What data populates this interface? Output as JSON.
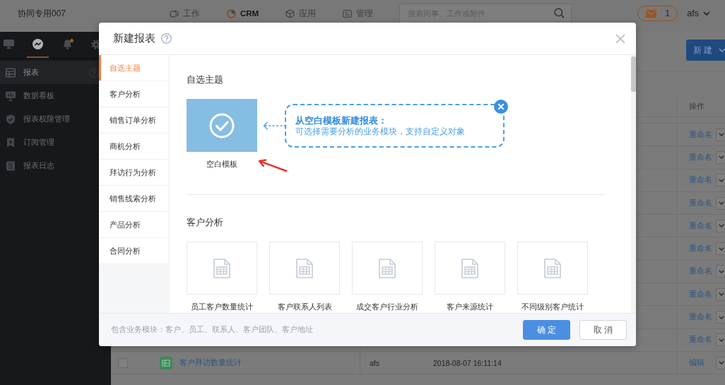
{
  "top_bar": {
    "company": "协同专用007",
    "nav": [
      {
        "label": "工作",
        "selected": false
      },
      {
        "label": "CRM",
        "selected": true
      },
      {
        "label": "应用",
        "selected": false
      },
      {
        "label": "管理",
        "selected": false
      }
    ],
    "search": {
      "placeholder": "搜索同事、工作或附件"
    },
    "messages": {
      "count": "1"
    },
    "user": "afs"
  },
  "sidebar": {
    "tabs": [
      {
        "selected": false,
        "unread": false
      },
      {
        "selected": true,
        "unread": false
      },
      {
        "selected": false,
        "unread": true
      },
      {
        "selected": false,
        "unread": false
      }
    ],
    "items": [
      {
        "label": "报表",
        "selected": true,
        "help": true
      },
      {
        "label": "数据看板",
        "selected": false,
        "help": false
      },
      {
        "label": "报表权限管理",
        "selected": false,
        "help": false
      },
      {
        "label": "订阅管理",
        "selected": false,
        "help": false
      },
      {
        "label": "报表日志",
        "selected": false,
        "help": false
      }
    ]
  },
  "main": {
    "new_button": "新 建",
    "table": {
      "action_header": "操作",
      "rows": [
        {
          "action": "重命名"
        },
        {
          "action": "重命名"
        },
        {
          "action": "重命名"
        },
        {
          "action": "重命名"
        },
        {
          "action": "重命名"
        },
        {
          "action": "重命名"
        },
        {
          "action": "重命名"
        },
        {
          "action": "重命名"
        },
        {
          "action": "重命名"
        },
        {
          "action": "重命名"
        },
        {
          "checked": false,
          "name": "客户拜访数量统计",
          "creator": "afs",
          "time": "2018-08-07 16:11:14",
          "action": "编辑"
        }
      ]
    }
  },
  "dialog": {
    "title": "新建报表",
    "nav": [
      {
        "label": "自选主题",
        "selected": true
      },
      {
        "label": "客户分析",
        "selected": false
      },
      {
        "label": "销售订单分析",
        "selected": false
      },
      {
        "label": "商机分析",
        "selected": false
      },
      {
        "label": "拜访行为分析",
        "selected": false
      },
      {
        "label": "销售线索分析",
        "selected": false
      },
      {
        "label": "产品分析",
        "selected": false
      },
      {
        "label": "合同分析",
        "selected": false
      }
    ],
    "sections": [
      {
        "title": "自选主题",
        "templates": [
          {
            "label": "空白模板",
            "selected": true
          }
        ],
        "callout": {
          "title": "从空白模板新建报表：",
          "text": "可选择需要分析的业务模块，支持自定义对象"
        }
      },
      {
        "title": "客户分析",
        "templates": [
          {
            "label": "员工客户数量统计",
            "selected": false
          },
          {
            "label": "客户联系人列表",
            "selected": false
          },
          {
            "label": "成交客户行业分析",
            "selected": false
          },
          {
            "label": "客户来源统计",
            "selected": false
          },
          {
            "label": "不同级别客户统计",
            "selected": false
          }
        ]
      }
    ],
    "footer_note": "包含业务模块：客户、员工、联系人、客户团队、客户地址",
    "buttons": [
      {
        "label": "确 定",
        "kind": "primary"
      },
      {
        "label": "取 消",
        "kind": "secondary"
      }
    ]
  }
}
